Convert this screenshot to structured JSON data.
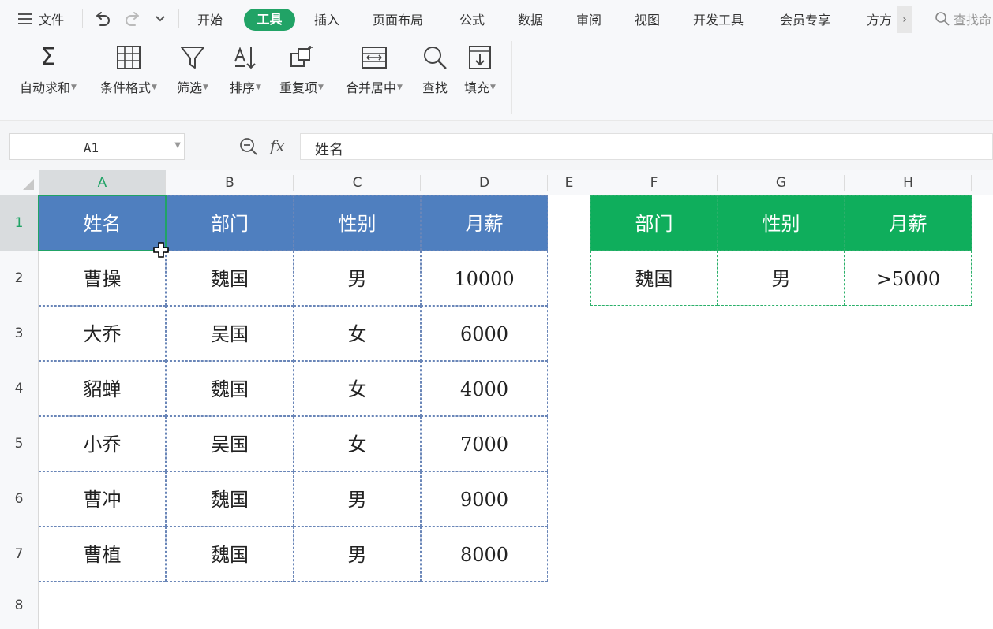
{
  "menubar": {
    "file": "文件",
    "tabs": [
      "开始",
      "工具",
      "插入",
      "页面布局",
      "公式",
      "数据",
      "审阅",
      "视图",
      "开发工具",
      "会员专享",
      "方方"
    ],
    "active_tab": "工具",
    "search": "查找命"
  },
  "ribbon": {
    "items": [
      "自动求和",
      "条件格式",
      "筛选",
      "排序",
      "重复项",
      "合并居中",
      "查找",
      "填充"
    ],
    "sum_symbol": "Σ"
  },
  "formula_bar": {
    "name_box": "A1",
    "fx": "fx",
    "formula": "姓名"
  },
  "sheet": {
    "columns": [
      "A",
      "B",
      "C",
      "D",
      "E",
      "F",
      "G",
      "H"
    ],
    "rows": [
      "1",
      "2",
      "3",
      "4",
      "5",
      "6",
      "7",
      "8"
    ],
    "selected_cell": "A1",
    "main_table": {
      "headers": [
        "姓名",
        "部门",
        "性别",
        "月薪"
      ],
      "rows": [
        [
          "曹操",
          "魏国",
          "男",
          "10000"
        ],
        [
          "大乔",
          "吴国",
          "女",
          "6000"
        ],
        [
          "貂蝉",
          "魏国",
          "女",
          "4000"
        ],
        [
          "小乔",
          "吴国",
          "女",
          "7000"
        ],
        [
          "曹冲",
          "魏国",
          "男",
          "9000"
        ],
        [
          "曹植",
          "魏国",
          "男",
          "8000"
        ]
      ]
    },
    "criteria_table": {
      "headers": [
        "部门",
        "性别",
        "月薪"
      ],
      "rows": [
        [
          "魏国",
          "男",
          ">5000"
        ]
      ]
    }
  },
  "colors": {
    "accent_green": "#21a366",
    "header_blue": "#4f7fbf",
    "header_green": "#0fae5c"
  }
}
